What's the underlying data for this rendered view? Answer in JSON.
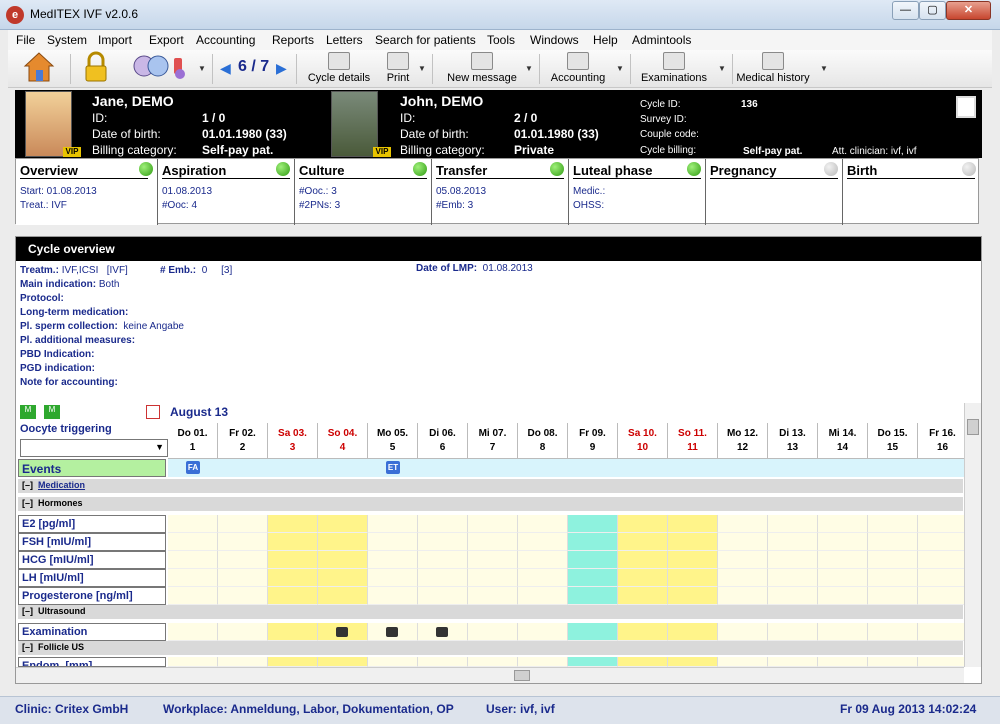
{
  "window": {
    "title": "MedITEX IVF v2.0.6",
    "min": "—",
    "max": "▢",
    "close": "✕"
  },
  "menu": [
    "File",
    "System",
    "Import",
    "Export",
    "Accounting",
    "Reports",
    "Letters",
    "Search for patients",
    "Tools",
    "Windows",
    "Help",
    "Admintools"
  ],
  "toolbar": {
    "pager": "6 / 7",
    "prev": "◀",
    "next": "▶",
    "cycle_details": "Cycle details",
    "print": "Print",
    "new_message": "New message",
    "accounting": "Accounting",
    "examinations": "Examinations",
    "medical_history": "Medical history",
    "dropdown": "▼"
  },
  "patient": {
    "female": {
      "name": "Jane, DEMO",
      "id_label": "ID:",
      "id": "1 / 0",
      "dob_label": "Date of birth:",
      "dob": "01.01.1980  (33)",
      "billing_label": "Billing category:",
      "billing": "Self-pay pat.",
      "vip": "VIP"
    },
    "male": {
      "name": "John, DEMO",
      "id_label": "ID:",
      "id": "2 / 0",
      "dob_label": "Date of birth:",
      "dob": "01.01.1980  (33)",
      "billing_label": "Billing category:",
      "billing": "Private",
      "vip": "VIP"
    },
    "cycle": {
      "cycle_id_label": "Cycle ID:",
      "cycle_id": "136",
      "survey_label": "Survey ID:",
      "couple_label": "Couple code:",
      "billing_label": "Cycle billing:",
      "billing": "Self-pay pat.",
      "clinician": "Att. clinician: ivf, ivf"
    }
  },
  "tabs": [
    {
      "title": "Overview",
      "l1": "Start: 01.08.2013",
      "l2": "Treat.: IVF",
      "dot": "green"
    },
    {
      "title": "Aspiration",
      "l1": "01.08.2013",
      "l2": "#Ooc: 4",
      "dot": "green"
    },
    {
      "title": "Culture",
      "l1": "#Ooc.: 3",
      "l2": "#2PNs: 3",
      "dot": "green"
    },
    {
      "title": "Transfer",
      "l1": "05.08.2013",
      "l2": "#Emb: 3",
      "dot": "green"
    },
    {
      "title": "Luteal phase",
      "l1": "Medic.:",
      "l2": "OHSS:",
      "dot": "green"
    },
    {
      "title": "Pregnancy",
      "l1": "",
      "l2": "",
      "dot": "grey"
    },
    {
      "title": "Birth",
      "l1": "",
      "l2": "",
      "dot": "grey"
    }
  ],
  "overview": {
    "header": "Cycle overview",
    "treatm_label": "Treatm.:",
    "treatm": "IVF,ICSI",
    "treatm_code": "[IVF]",
    "emb_label": "# Emb.:",
    "emb": "0",
    "emb_code": "[3]",
    "lmp_label": "Date of LMP:",
    "lmp": "01.08.2013",
    "main_ind_label": "Main indication:",
    "main_ind": "Both",
    "protocol_label": "Protocol:",
    "ltm_label": "Long-term medication:",
    "sperm_label": "Pl. sperm collection:",
    "sperm": "keine Angabe",
    "addl_label": "Pl. additional measures:",
    "pbd_label": "PBD Indication:",
    "pgd_label": "PGD indication:",
    "note_label": "Note for accounting:"
  },
  "calendar": {
    "month": "August 13",
    "trigger_label": "Oocyte triggering",
    "events_label": "Events",
    "days": [
      {
        "d": "Do 01.",
        "n": "1"
      },
      {
        "d": "Fr 02.",
        "n": "2"
      },
      {
        "d": "Sa 03.",
        "n": "3"
      },
      {
        "d": "So 04.",
        "n": "4"
      },
      {
        "d": "Mo 05.",
        "n": "5"
      },
      {
        "d": "Di 06.",
        "n": "6"
      },
      {
        "d": "Mi 07.",
        "n": "7"
      },
      {
        "d": "Do 08.",
        "n": "8"
      },
      {
        "d": "Fr 09.",
        "n": "9"
      },
      {
        "d": "Sa 10.",
        "n": "10"
      },
      {
        "d": "So 11.",
        "n": "11"
      },
      {
        "d": "Mo 12.",
        "n": "12"
      },
      {
        "d": "Di 13.",
        "n": "13"
      },
      {
        "d": "Mi 14.",
        "n": "14"
      },
      {
        "d": "Do 15.",
        "n": "15"
      },
      {
        "d": "Fr 16.",
        "n": "16"
      }
    ],
    "event_fa": "FA",
    "event_et": "ET",
    "sect_medication": "Medication",
    "sect_hormones": "Hormones",
    "hormones": [
      "E2  [pg/ml]",
      "FSH  [mIU/ml]",
      "HCG  [mIU/ml]",
      "LH  [mIU/ml]",
      "Progesterone  [ng/ml]"
    ],
    "sect_ultrasound": "Ultrasound",
    "examination": "Examination",
    "sect_follicle": "Follicle US",
    "endom": "Endom. [mm]",
    "collapse": "[–]"
  },
  "status": {
    "clinic": "Clinic: Critex GmbH",
    "workplace": "Workplace: Anmeldung, Labor, Dokumentation, OP",
    "user": "User: ivf, ivf",
    "datetime": "Fr 09 Aug 2013 14:02:24"
  }
}
